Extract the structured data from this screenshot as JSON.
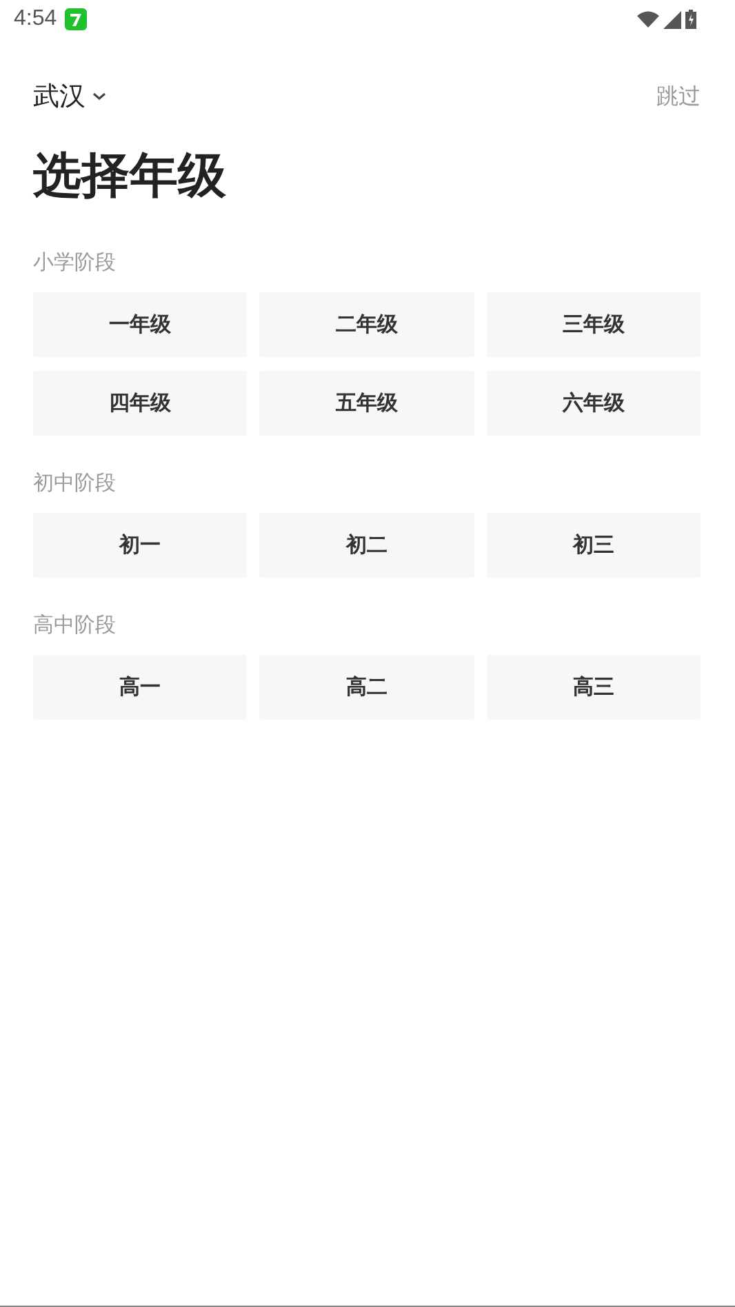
{
  "status_bar": {
    "time": "4:54"
  },
  "header": {
    "city": "武汉",
    "skip": "跳过"
  },
  "title": "选择年级",
  "sections": [
    {
      "label": "小学阶段",
      "grades": [
        "一年级",
        "二年级",
        "三年级",
        "四年级",
        "五年级",
        "六年级"
      ]
    },
    {
      "label": "初中阶段",
      "grades": [
        "初一",
        "初二",
        "初三"
      ]
    },
    {
      "label": "高中阶段",
      "grades": [
        "高一",
        "高二",
        "高三"
      ]
    }
  ]
}
